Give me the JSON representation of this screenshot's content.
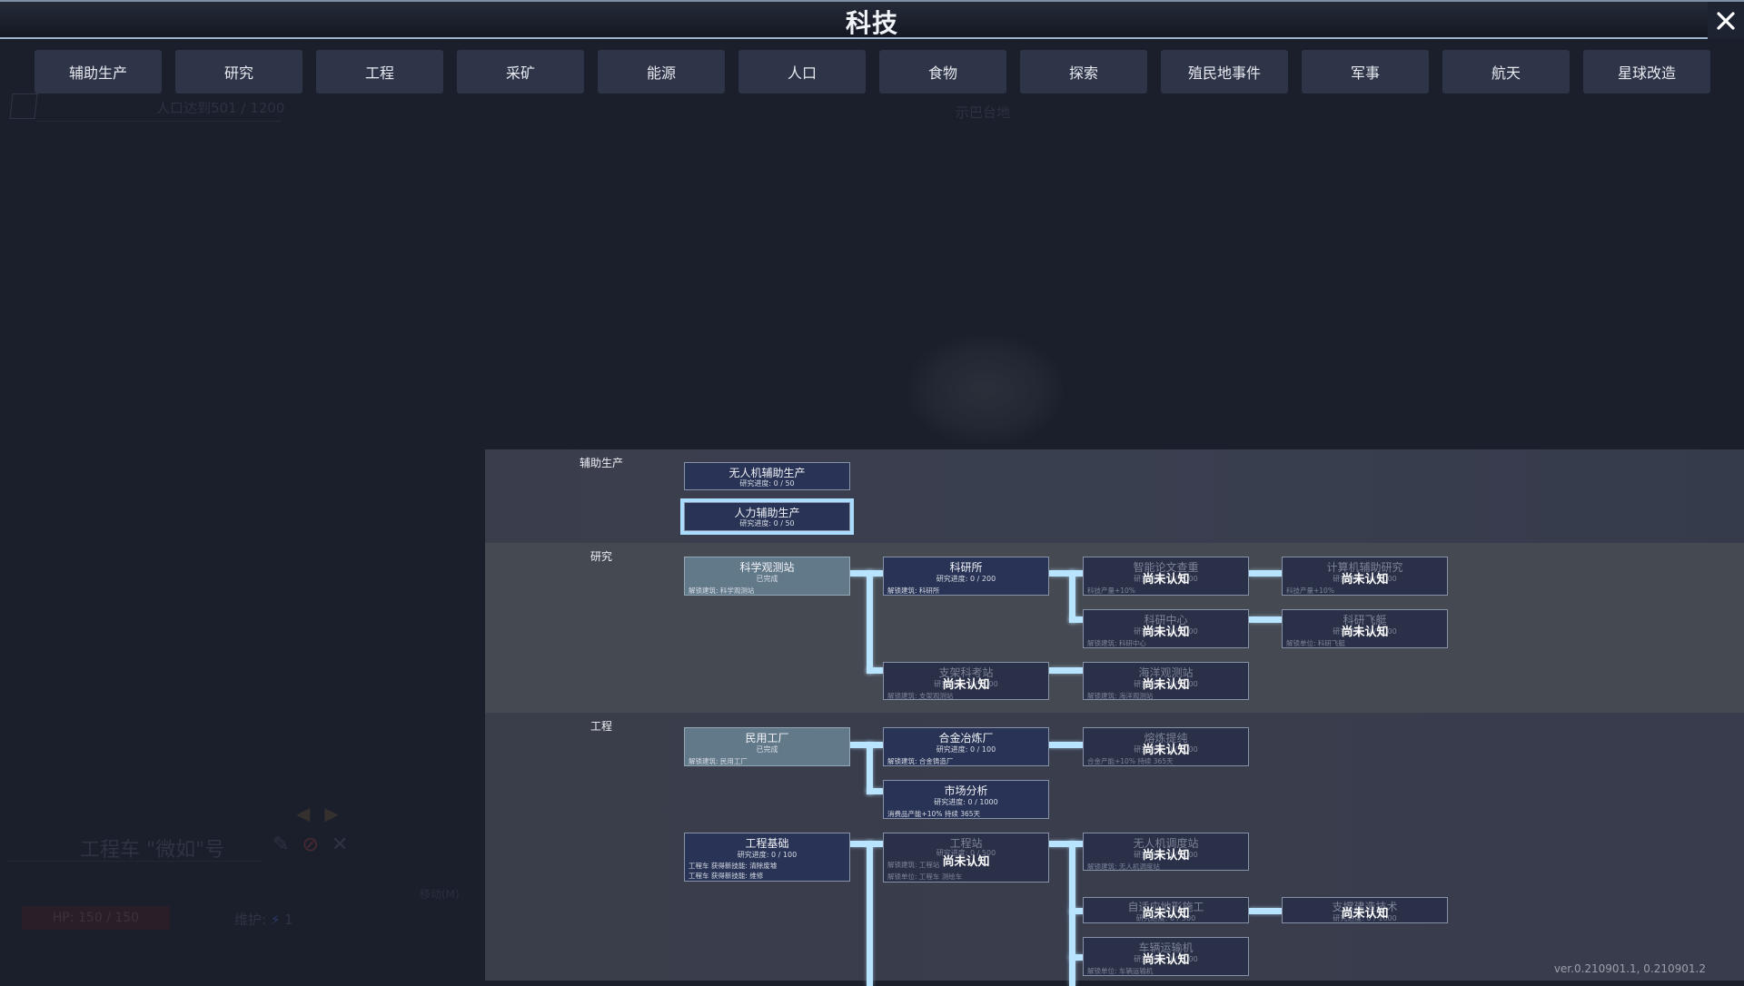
{
  "window": {
    "title": "科技",
    "close_label": "close"
  },
  "tabs": [
    {
      "label": "辅助生产"
    },
    {
      "label": "研究"
    },
    {
      "label": "工程"
    },
    {
      "label": "采矿"
    },
    {
      "label": "能源"
    },
    {
      "label": "人口"
    },
    {
      "label": "食物"
    },
    {
      "label": "探索"
    },
    {
      "label": "殖民地事件"
    },
    {
      "label": "军事"
    },
    {
      "label": "航天"
    },
    {
      "label": "星球改造"
    }
  ],
  "background": {
    "population_goal": "人口达到501 / 1200",
    "location_name": "示巴台地",
    "unit_name": "工程车 \"微如\"号",
    "hp": "HP: 150 / 150",
    "maintenance_label": "维护:",
    "maintenance_value": "1",
    "move_label": "移动(M)"
  },
  "tree": {
    "rows": [
      {
        "label": "辅助生产"
      },
      {
        "label": "研究"
      },
      {
        "label": "工程"
      }
    ],
    "unknown_label": "尚未认知",
    "nodes": {
      "drone_assist": {
        "title": "无人机辅助生产",
        "progress": "研究进度: 0 / 50",
        "state": "available"
      },
      "manual_assist": {
        "title": "人力辅助生产",
        "progress": "研究进度: 0 / 50",
        "state": "available",
        "selected": true
      },
      "science_station": {
        "title": "科学观测站",
        "progress": "已完成",
        "effect1": "解锁建筑: 科学观测站",
        "state": "completed"
      },
      "research_institute": {
        "title": "科研所",
        "progress": "研究进度: 0 / 200",
        "effect1": "解锁建筑: 科研所",
        "state": "available"
      },
      "paper_check": {
        "title": "智能论文查重",
        "progress": "研究进度: 0 / 1000",
        "effect1": "科技产量+10%",
        "state": "unknown"
      },
      "computer_research": {
        "title": "计算机辅助研究",
        "progress": "研究进度: 0 / 1000",
        "effect1": "科技产量+10%",
        "state": "unknown"
      },
      "research_center": {
        "title": "科研中心",
        "progress": "研究进度: 0 / 1000",
        "effect1": "解锁建筑: 科研中心",
        "state": "unknown"
      },
      "research_airship": {
        "title": "科研飞艇",
        "progress": "研究进度: 0 / 1000",
        "effect1": "解锁单位: 科研飞艇",
        "state": "unknown"
      },
      "stilt_station": {
        "title": "支架科考站",
        "progress": "研究进度: 0 / 1000",
        "effect1": "解锁建筑: 支架观测站",
        "state": "unknown"
      },
      "ocean_station": {
        "title": "海洋观测站",
        "progress": "研究进度: 0 / 1000",
        "effect1": "解锁建筑: 海洋观测站",
        "state": "unknown"
      },
      "civil_factory": {
        "title": "民用工厂",
        "progress": "已完成",
        "effect1": "解锁建筑: 民用工厂",
        "state": "completed"
      },
      "alloy_smelter": {
        "title": "合金冶炼厂",
        "progress": "研究进度: 0 / 100",
        "effect1": "解锁建筑: 合金铸造厂",
        "state": "available"
      },
      "refining": {
        "title": "熔炼提纯",
        "progress": "研究进度: 0 / 1000",
        "effect1": "合金产能+10% 持续 365天",
        "state": "unknown"
      },
      "market_analysis": {
        "title": "市场分析",
        "progress": "研究进度: 0 / 1000",
        "effect1": "消费品产能+10% 持续 365天",
        "state": "available"
      },
      "engineering_basics": {
        "title": "工程基础",
        "progress": "研究进度: 0 / 100",
        "effect1": "工程车 获得新技能: 清除废墟",
        "effect2": "工程车 获得新技能: 维修",
        "state": "available"
      },
      "engineering_station": {
        "title": "工程站",
        "progress": "研究进度: 0 / 500",
        "effect1": "解锁建筑: 工程站",
        "effect2": "解锁单位: 工程车 测绘车",
        "state": "unknown"
      },
      "drone_dispatch": {
        "title": "无人机调度站",
        "progress": "研究进度: 0 / 1000",
        "effect1": "解锁建筑: 无人机调度站",
        "state": "unknown"
      },
      "adaptive_terrain": {
        "title": "自适应地形施工",
        "progress": "研究进度: 0 / 500",
        "state": "unknown"
      },
      "support_building": {
        "title": "支撑建造技术",
        "progress": "研究进度: 0 / 1000",
        "state": "unknown"
      },
      "vehicle_transport": {
        "title": "车辆运输机",
        "progress": "研究进度: 0 / 1000",
        "effect1": "解锁单位: 车辆运输机",
        "state": "unknown"
      }
    }
  },
  "version": "ver.0.210901.1, 0.210901.2",
  "colors": {
    "accent_connector": "#b9e4ff",
    "node_available": "#283355",
    "node_completed": "#62798a",
    "node_unknown": "#2a3048",
    "tab_bg": "#2f3548",
    "background": "#1b1f2b"
  }
}
